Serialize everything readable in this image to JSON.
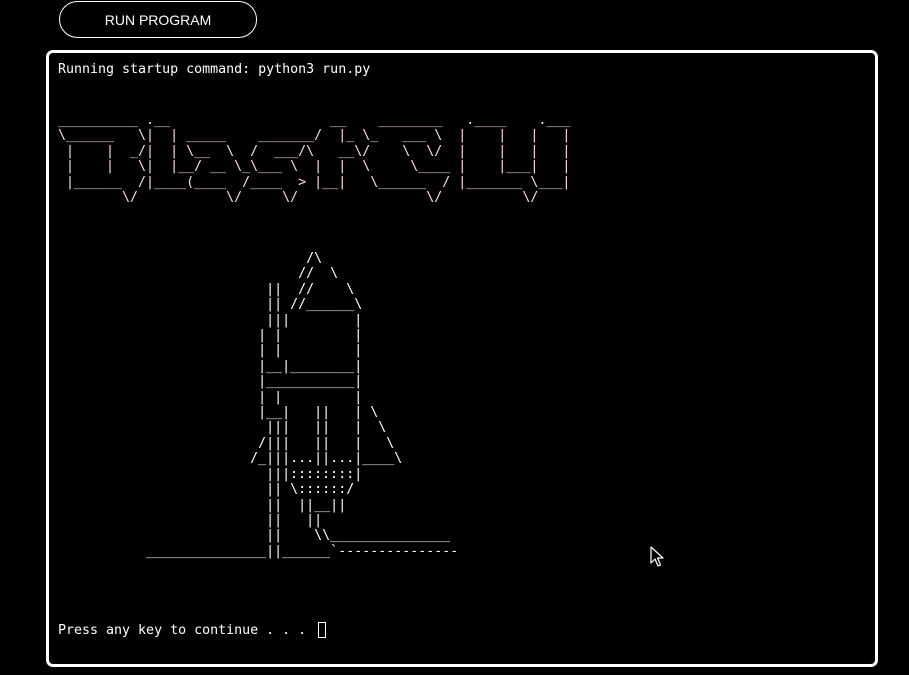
{
  "toolbar": {
    "run_label": "RUN PROGRAM"
  },
  "terminal": {
    "startup_line": "Running startup command: python3 run.py",
    "logo_art": "__________ .__                    __    ________   .____    .___\n\\______   \\|  | _____    _______/  |_ \\_   ___ \\  |    |   |   |\n |    |  _/|  | \\__  \\  /  ___/\\   __\\/    \\  \\/  |    |   |   |\n |    |   \\|  |__/ __ \\_\\___ \\  |  |  \\     \\____ |    |___|   |\n |______  /|____(____  /____  > |__|   \\______  / |_______ \\___|\n        \\/           \\/     \\/                \\/          \\/    ",
    "rocket_art": "                               /\\\n                              //  \\\n                          ||  //    \\\n                          || //______\\\n                          |||        |\n                         | |         |\n                         | |         |\n                         |__|________|\n                         |___________|\n                         | |         |\n                         |__|   ||   | \\\n                          |||   ||   |  \\\n                         /|||   ||   |   \\\n                        /_|||...||...|____\\\n                          |||::::::::|\n                          || \\::::::/\n                          ||  ||__||\n                          ||   ||\n                          ||    \\\\_______________\n           _______________||______`---------------",
    "prompt": "Press any key to continue . . . "
  },
  "icons": {
    "pointer": "mouse-pointer-icon"
  }
}
